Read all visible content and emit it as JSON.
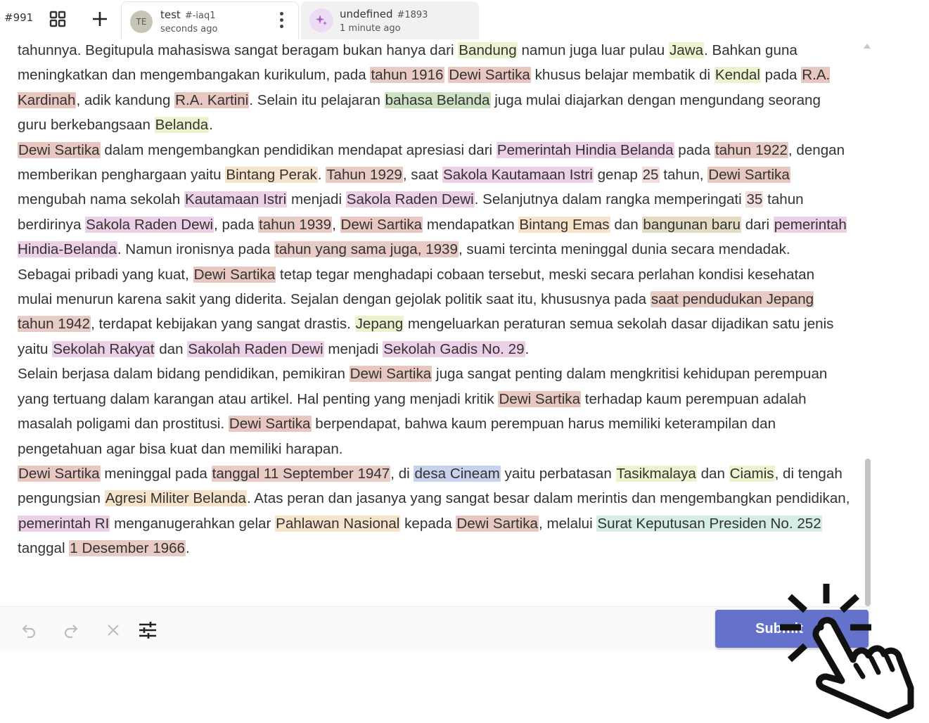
{
  "header": {
    "task_id": "#991",
    "tabs": [
      {
        "avatar": "TE",
        "title": "test",
        "id": "#-iaq1",
        "time": "seconds ago",
        "active": true
      },
      {
        "avatar": "sparkle-icon",
        "title": "undefined",
        "id": "#1893",
        "time": "1 minute ago",
        "active": false
      }
    ]
  },
  "content": {
    "paragraphs": [
      [
        {
          "t": "tahunnya. Begitupula mahasiswa sangat beragam bukan hanya dari "
        },
        {
          "t": "Bandung",
          "c": "loc"
        },
        {
          "t": " namun juga luar pulau "
        },
        {
          "t": "Jawa",
          "c": "loc"
        },
        {
          "t": ". Bahkan guna meningkatkan dan mengembangakan kurikulum, pada "
        },
        {
          "t": "tahun 1916",
          "c": "dat"
        },
        {
          "t": " "
        },
        {
          "t": "Dewi Sartika",
          "c": "per"
        },
        {
          "t": " khusus belajar membatik di "
        },
        {
          "t": "Kendal",
          "c": "loc"
        },
        {
          "t": " pada "
        },
        {
          "t": "R.A. Kardinah",
          "c": "per"
        },
        {
          "t": ", adik kandung "
        },
        {
          "t": "R.A. Kartini",
          "c": "per"
        },
        {
          "t": ". Selain itu pelajaran "
        },
        {
          "t": "bahasa Belanda",
          "c": "lng"
        },
        {
          "t": " juga mulai diajarkan dengan mengundang seorang guru berkebangsaan "
        },
        {
          "t": "Belanda",
          "c": "loc"
        },
        {
          "t": "."
        }
      ],
      [
        {
          "t": "Dewi Sartika",
          "c": "per"
        },
        {
          "t": " dalam mengembangkan pendidikan mendapat apresiasi dari "
        },
        {
          "t": "Pemerintah Hindia Belanda",
          "c": "org"
        },
        {
          "t": " pada "
        },
        {
          "t": "tahun 1922",
          "c": "dat"
        },
        {
          "t": ", dengan memberikan penghargaan yaitu "
        },
        {
          "t": "Bintang Perak",
          "c": "awd"
        },
        {
          "t": ". "
        },
        {
          "t": "Tahun 1929",
          "c": "dat"
        },
        {
          "t": ", saat "
        },
        {
          "t": "Sakola Kautamaan Istri",
          "c": "org"
        },
        {
          "t": " genap "
        },
        {
          "t": "25",
          "c": "num"
        },
        {
          "t": " tahun, "
        },
        {
          "t": "Dewi Sartika",
          "c": "per"
        },
        {
          "t": " mengubah nama sekolah "
        },
        {
          "t": "Kautamaan Istri",
          "c": "org"
        },
        {
          "t": " menjadi "
        },
        {
          "t": "Sakola Raden Dewi",
          "c": "org"
        },
        {
          "t": ". Selanjutnya dalam rangka memperingati "
        },
        {
          "t": "35",
          "c": "num"
        },
        {
          "t": " tahun berdirinya "
        },
        {
          "t": "Sakola Raden Dewi",
          "c": "org"
        },
        {
          "t": ", pada "
        },
        {
          "t": "tahun 1939",
          "c": "dat"
        },
        {
          "t": ", "
        },
        {
          "t": "Dewi Sartika",
          "c": "per"
        },
        {
          "t": " mendapatkan "
        },
        {
          "t": "Bintang Emas",
          "c": "awd"
        },
        {
          "t": " dan "
        },
        {
          "t": "bangunan baru",
          "c": "thg"
        },
        {
          "t": " dari "
        },
        {
          "t": "pemerintah Hindia-Belanda",
          "c": "org"
        },
        {
          "t": ". Namun ironisnya pada "
        },
        {
          "t": "tahun yang sama juga, 1939",
          "c": "dat"
        },
        {
          "t": ", suami tercinta meninggal dunia secara mendadak."
        }
      ],
      [
        {
          "t": "Sebagai pribadi yang kuat, "
        },
        {
          "t": "Dewi Sartika",
          "c": "per"
        },
        {
          "t": " tetap tegar menghadapi cobaan tersebut, meski secara perlahan kondisi kesehatan mulai menurun karena sakit yang diderita. Sejalan dengan gejolak politik saat itu, khususnya pada "
        },
        {
          "t": "saat pendudukan Jepang tahun 1942",
          "c": "dat"
        },
        {
          "t": ", terdapat kebijakan yang sangat drastis. "
        },
        {
          "t": "Jepang",
          "c": "loc"
        },
        {
          "t": " mengeluarkan peraturan semua sekolah dasar dijadikan satu jenis yaitu "
        },
        {
          "t": "Sekolah Rakyat",
          "c": "org"
        },
        {
          "t": " dan "
        },
        {
          "t": "Sakolah Raden Dewi",
          "c": "org"
        },
        {
          "t": " menjadi "
        },
        {
          "t": "Sekolah Gadis No. 29",
          "c": "org"
        },
        {
          "t": "."
        }
      ],
      [
        {
          "t": "Selain berjasa dalam bidang pendidikan, pemikiran "
        },
        {
          "t": "Dewi Sartika",
          "c": "per"
        },
        {
          "t": " juga sangat penting dalam mengkritisi kehidupan perempuan yang tertuang dalam karangan atau artikel. Hal penting yang menjadi kritik "
        },
        {
          "t": "Dewi Sartika",
          "c": "per"
        },
        {
          "t": " terhadap kaum perempuan adalah masalah poligami dan prostitusi. "
        },
        {
          "t": "Dewi Sartika",
          "c": "per"
        },
        {
          "t": " berpendapat, bahwa kaum perempuan harus memiliki keterampilan dan pengetahuan agar bisa kuat dan memiliki harapan."
        }
      ],
      [
        {
          "t": "Dewi Sartika",
          "c": "per"
        },
        {
          "t": " meninggal pada "
        },
        {
          "t": "tanggal 11 September 1947",
          "c": "dat"
        },
        {
          "t": ", di "
        },
        {
          "t": "desa Cineam",
          "c": "pla"
        },
        {
          "t": " yaitu perbatasan "
        },
        {
          "t": "Tasikmalaya",
          "c": "loc"
        },
        {
          "t": " dan "
        },
        {
          "t": "Ciamis",
          "c": "loc"
        },
        {
          "t": ", di tengah pengungsian "
        },
        {
          "t": "Agresi Militer Belanda",
          "c": "awd"
        },
        {
          "t": ". Atas peran dan jasanya yang sangat besar dalam merintis dan mengembangkan pendidikan, "
        },
        {
          "t": "pemerintah RI",
          "c": "org"
        },
        {
          "t": " menganugerahkan gelar "
        },
        {
          "t": "Pahlawan Nasional",
          "c": "awd"
        },
        {
          "t": " kepada "
        },
        {
          "t": "Dewi Sartika",
          "c": "per"
        },
        {
          "t": ", melalui "
        },
        {
          "t": "Surat Keputusan Presiden No. 252",
          "c": "doc"
        },
        {
          "t": " tanggal "
        },
        {
          "t": "1 Desember 1966",
          "c": "dat"
        },
        {
          "t": "."
        }
      ]
    ]
  },
  "toolbar": {
    "submit_label": "Submit"
  }
}
